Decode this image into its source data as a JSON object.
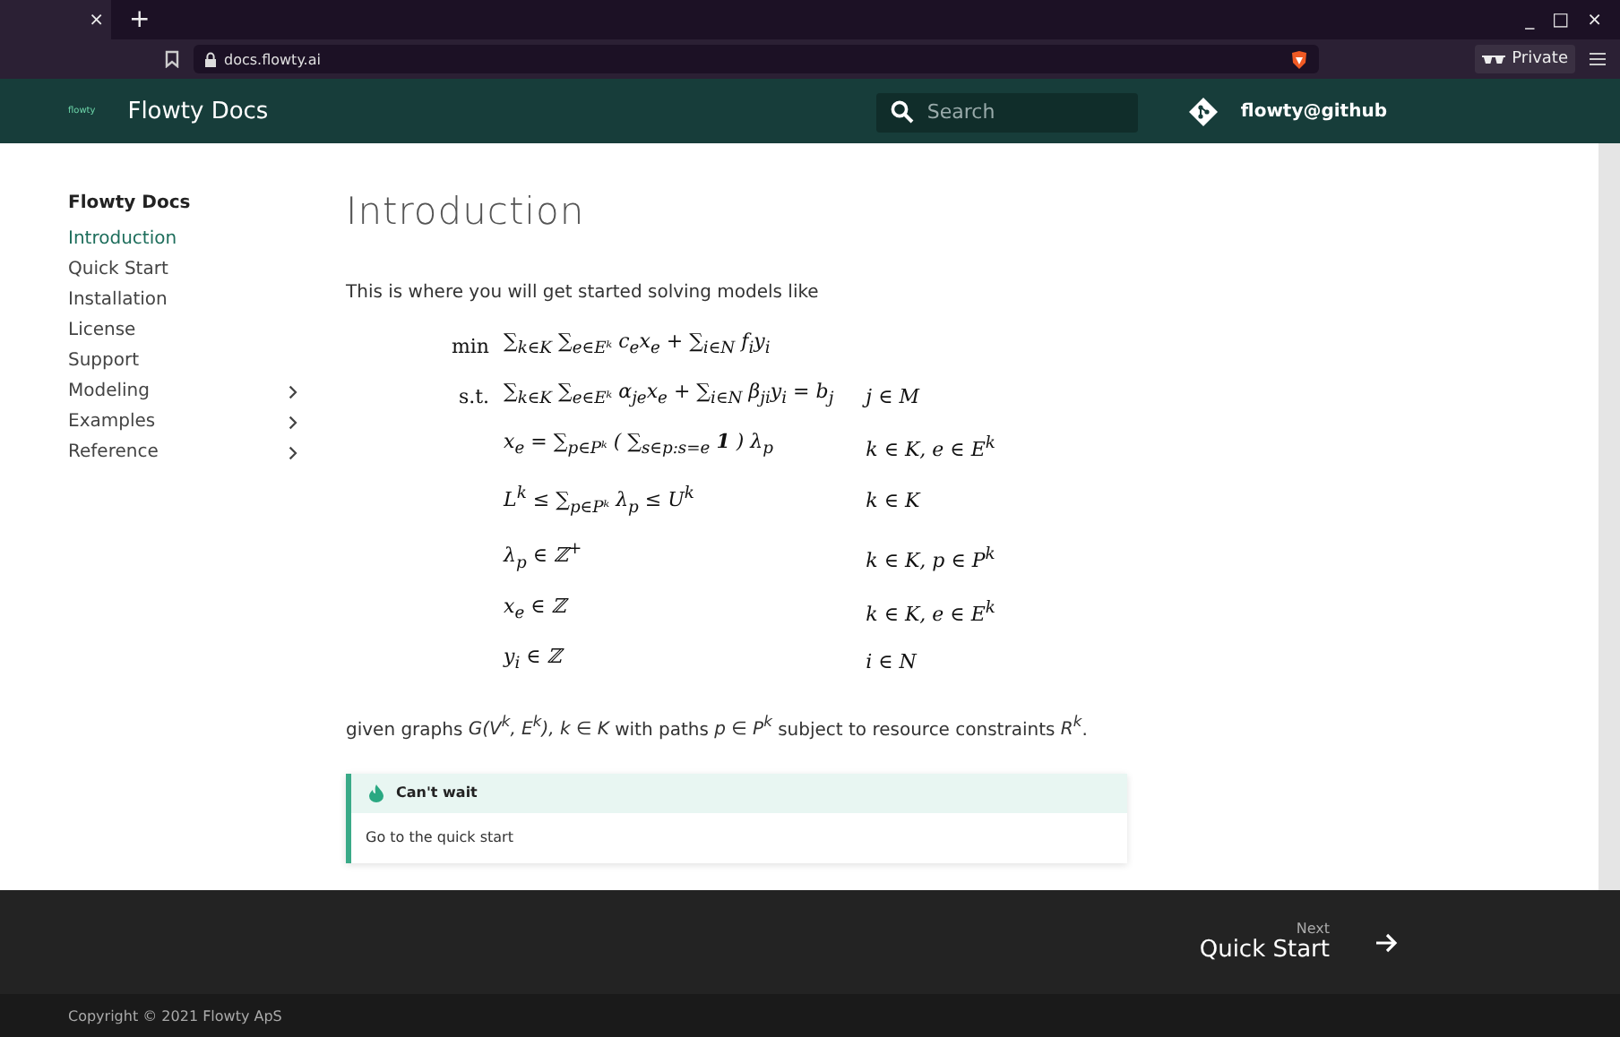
{
  "browser": {
    "tab_close": "×",
    "new_tab": "+",
    "url": "docs.flowty.ai",
    "private_label": "Private",
    "window_controls": [
      "_",
      "□",
      "×"
    ]
  },
  "header": {
    "logo_text": "flowty",
    "title": "Flowty Docs",
    "search": {
      "placeholder": "Search"
    },
    "repo_link": "flowty@github"
  },
  "sidebar": {
    "title": "Flowty Docs",
    "items": [
      {
        "label": "Introduction",
        "selected": true,
        "kind": "page"
      },
      {
        "label": "Quick Start",
        "selected": false,
        "kind": "page"
      },
      {
        "label": "Installation",
        "selected": false,
        "kind": "page"
      },
      {
        "label": "License",
        "selected": false,
        "kind": "page"
      },
      {
        "label": "Support",
        "selected": false,
        "kind": "page"
      },
      {
        "label": "Modeling",
        "selected": false,
        "kind": "group"
      },
      {
        "label": "Examples",
        "selected": false,
        "kind": "group"
      },
      {
        "label": "Reference",
        "selected": false,
        "kind": "group"
      }
    ]
  },
  "content": {
    "title": "Introduction",
    "intro": "This is where you will get started solving models like",
    "equations": [
      {
        "label": "min",
        "expr": "∑$_{k∈K}$ ∑$_{e∈Eᵏ}$ c$_{e}$x$_{e}$ + ∑$_{i∈N}$ f$_{i}$y$_{i}$"
      },
      {
        "label": "s.t.",
        "expr": "∑$_{k∈K}$ ∑$_{e∈Eᵏ}$ α$_{je}$x$_{e}$ + ∑$_{i∈N}$ β$_{ji}$y$_{i}$ = b$_{j}$",
        "condition": "j ∈ M"
      },
      {
        "expr": "x$_{e}$ = ∑$_{p∈Pᵏ}$ ( ∑$_{s∈p:s=e}$ **1** ) λ$_{p}$",
        "condition": "k ∈ K, e ∈ E$^{k}$"
      },
      {
        "expr": "L$^{k}$ ≤ ∑$_{p∈Pᵏ}$ λ$_{p}$ ≤ U$^{k}$",
        "condition": "k ∈ K"
      },
      {
        "expr": "λ$_{p}$ ∈ ℤ$^{+}$",
        "condition": "k ∈ K, p ∈ P$^{k}$"
      },
      {
        "expr": "x$_{e}$ ∈ ℤ",
        "condition": "k ∈ K, e ∈ E$^{k}$"
      },
      {
        "expr": "y$_{i}$ ∈ ℤ",
        "condition": "i ∈ N"
      }
    ],
    "after": "given graphs *G(V$^{k}$, E$^{k}$), k ∈ K* with paths *p ∈ P$^{k}$* subject to resource constraints *R$^{k}$*.",
    "callout": {
      "title": "Can't wait",
      "link": "Go to the quick start"
    }
  },
  "footer": {
    "next_label": "Next",
    "next_title": "Quick Start",
    "copyright": "Copyright © 2021 Flowty ApS"
  }
}
